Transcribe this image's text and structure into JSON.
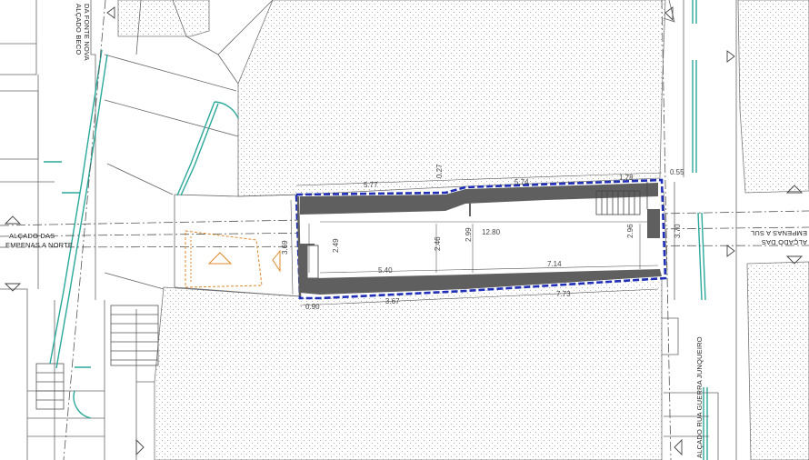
{
  "labels": {
    "elev_beco_line1": "ALÇADO BECO",
    "elev_beco_line2": "DA FONTE NOVA",
    "elev_empenas_norte_line1": "ALÇADO DAS",
    "elev_empenas_norte_line2": "EMPENAS A NORTE",
    "elev_empenas_sul_line1": "ALÇADO DAS",
    "elev_empenas_sul_line2": "EMPENAS A SUL",
    "elev_rua_guerra": "ALÇADO RUA GUERRA JUNQUEIRO"
  },
  "dimensions": {
    "top_left": "5.77",
    "top_step": "0.27",
    "top_mid": "5.74",
    "top_right": "1.78",
    "top_corner": "0.55",
    "right_height": "3.70",
    "left_height": "3.69",
    "inner_h1": "2.49",
    "inner_h2": "2.46",
    "inner_h3": "2.99",
    "inner_h4": "2.96",
    "inner_length": "12.80",
    "inner_left": "5.40",
    "inner_right": "7.14",
    "bottom_corner": "0.90",
    "bottom_mid": "3.67",
    "bottom_right": "7.73"
  },
  "colors": {
    "line": "#555555",
    "hatch_dot": "#9a9a9a",
    "wall_fill": "#5f5f5f",
    "boundary": "#1f2fb8",
    "glass": "#2aa89a",
    "orange": "#e0892a"
  }
}
